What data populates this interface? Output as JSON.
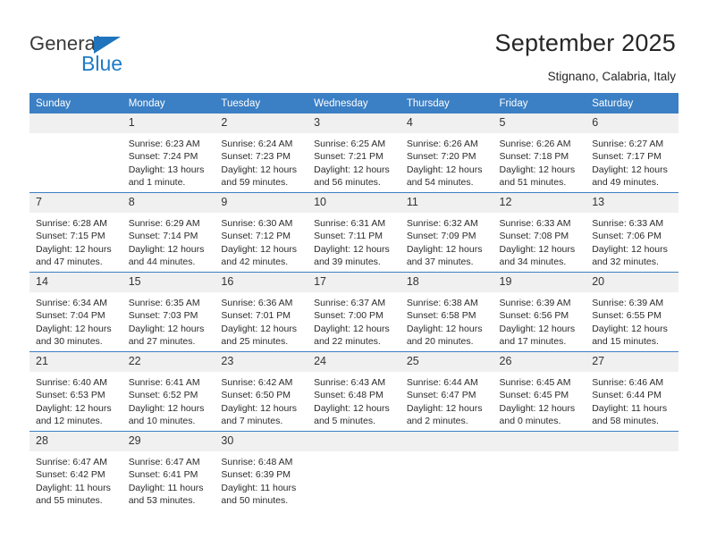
{
  "brand": {
    "name_part1": "General",
    "name_part2": "Blue",
    "accent_color": "#1f7bc6",
    "triangle_color": "#1f74bd"
  },
  "header": {
    "title": "September 2025",
    "subtitle": "Stignano, Calabria, Italy",
    "header_bg": "#3b7fc4",
    "daynum_bg": "#f0f0f0"
  },
  "weekday_headers": [
    "Sunday",
    "Monday",
    "Tuesday",
    "Wednesday",
    "Thursday",
    "Friday",
    "Saturday"
  ],
  "weeks": [
    [
      {
        "day": "",
        "lines": []
      },
      {
        "day": "1",
        "lines": [
          "Sunrise: 6:23 AM",
          "Sunset: 7:24 PM",
          "Daylight: 13 hours",
          "and 1 minute."
        ]
      },
      {
        "day": "2",
        "lines": [
          "Sunrise: 6:24 AM",
          "Sunset: 7:23 PM",
          "Daylight: 12 hours",
          "and 59 minutes."
        ]
      },
      {
        "day": "3",
        "lines": [
          "Sunrise: 6:25 AM",
          "Sunset: 7:21 PM",
          "Daylight: 12 hours",
          "and 56 minutes."
        ]
      },
      {
        "day": "4",
        "lines": [
          "Sunrise: 6:26 AM",
          "Sunset: 7:20 PM",
          "Daylight: 12 hours",
          "and 54 minutes."
        ]
      },
      {
        "day": "5",
        "lines": [
          "Sunrise: 6:26 AM",
          "Sunset: 7:18 PM",
          "Daylight: 12 hours",
          "and 51 minutes."
        ]
      },
      {
        "day": "6",
        "lines": [
          "Sunrise: 6:27 AM",
          "Sunset: 7:17 PM",
          "Daylight: 12 hours",
          "and 49 minutes."
        ]
      }
    ],
    [
      {
        "day": "7",
        "lines": [
          "Sunrise: 6:28 AM",
          "Sunset: 7:15 PM",
          "Daylight: 12 hours",
          "and 47 minutes."
        ]
      },
      {
        "day": "8",
        "lines": [
          "Sunrise: 6:29 AM",
          "Sunset: 7:14 PM",
          "Daylight: 12 hours",
          "and 44 minutes."
        ]
      },
      {
        "day": "9",
        "lines": [
          "Sunrise: 6:30 AM",
          "Sunset: 7:12 PM",
          "Daylight: 12 hours",
          "and 42 minutes."
        ]
      },
      {
        "day": "10",
        "lines": [
          "Sunrise: 6:31 AM",
          "Sunset: 7:11 PM",
          "Daylight: 12 hours",
          "and 39 minutes."
        ]
      },
      {
        "day": "11",
        "lines": [
          "Sunrise: 6:32 AM",
          "Sunset: 7:09 PM",
          "Daylight: 12 hours",
          "and 37 minutes."
        ]
      },
      {
        "day": "12",
        "lines": [
          "Sunrise: 6:33 AM",
          "Sunset: 7:08 PM",
          "Daylight: 12 hours",
          "and 34 minutes."
        ]
      },
      {
        "day": "13",
        "lines": [
          "Sunrise: 6:33 AM",
          "Sunset: 7:06 PM",
          "Daylight: 12 hours",
          "and 32 minutes."
        ]
      }
    ],
    [
      {
        "day": "14",
        "lines": [
          "Sunrise: 6:34 AM",
          "Sunset: 7:04 PM",
          "Daylight: 12 hours",
          "and 30 minutes."
        ]
      },
      {
        "day": "15",
        "lines": [
          "Sunrise: 6:35 AM",
          "Sunset: 7:03 PM",
          "Daylight: 12 hours",
          "and 27 minutes."
        ]
      },
      {
        "day": "16",
        "lines": [
          "Sunrise: 6:36 AM",
          "Sunset: 7:01 PM",
          "Daylight: 12 hours",
          "and 25 minutes."
        ]
      },
      {
        "day": "17",
        "lines": [
          "Sunrise: 6:37 AM",
          "Sunset: 7:00 PM",
          "Daylight: 12 hours",
          "and 22 minutes."
        ]
      },
      {
        "day": "18",
        "lines": [
          "Sunrise: 6:38 AM",
          "Sunset: 6:58 PM",
          "Daylight: 12 hours",
          "and 20 minutes."
        ]
      },
      {
        "day": "19",
        "lines": [
          "Sunrise: 6:39 AM",
          "Sunset: 6:56 PM",
          "Daylight: 12 hours",
          "and 17 minutes."
        ]
      },
      {
        "day": "20",
        "lines": [
          "Sunrise: 6:39 AM",
          "Sunset: 6:55 PM",
          "Daylight: 12 hours",
          "and 15 minutes."
        ]
      }
    ],
    [
      {
        "day": "21",
        "lines": [
          "Sunrise: 6:40 AM",
          "Sunset: 6:53 PM",
          "Daylight: 12 hours",
          "and 12 minutes."
        ]
      },
      {
        "day": "22",
        "lines": [
          "Sunrise: 6:41 AM",
          "Sunset: 6:52 PM",
          "Daylight: 12 hours",
          "and 10 minutes."
        ]
      },
      {
        "day": "23",
        "lines": [
          "Sunrise: 6:42 AM",
          "Sunset: 6:50 PM",
          "Daylight: 12 hours",
          "and 7 minutes."
        ]
      },
      {
        "day": "24",
        "lines": [
          "Sunrise: 6:43 AM",
          "Sunset: 6:48 PM",
          "Daylight: 12 hours",
          "and 5 minutes."
        ]
      },
      {
        "day": "25",
        "lines": [
          "Sunrise: 6:44 AM",
          "Sunset: 6:47 PM",
          "Daylight: 12 hours",
          "and 2 minutes."
        ]
      },
      {
        "day": "26",
        "lines": [
          "Sunrise: 6:45 AM",
          "Sunset: 6:45 PM",
          "Daylight: 12 hours",
          "and 0 minutes."
        ]
      },
      {
        "day": "27",
        "lines": [
          "Sunrise: 6:46 AM",
          "Sunset: 6:44 PM",
          "Daylight: 11 hours",
          "and 58 minutes."
        ]
      }
    ],
    [
      {
        "day": "28",
        "lines": [
          "Sunrise: 6:47 AM",
          "Sunset: 6:42 PM",
          "Daylight: 11 hours",
          "and 55 minutes."
        ]
      },
      {
        "day": "29",
        "lines": [
          "Sunrise: 6:47 AM",
          "Sunset: 6:41 PM",
          "Daylight: 11 hours",
          "and 53 minutes."
        ]
      },
      {
        "day": "30",
        "lines": [
          "Sunrise: 6:48 AM",
          "Sunset: 6:39 PM",
          "Daylight: 11 hours",
          "and 50 minutes."
        ]
      },
      {
        "day": "",
        "lines": []
      },
      {
        "day": "",
        "lines": []
      },
      {
        "day": "",
        "lines": []
      },
      {
        "day": "",
        "lines": []
      }
    ]
  ]
}
